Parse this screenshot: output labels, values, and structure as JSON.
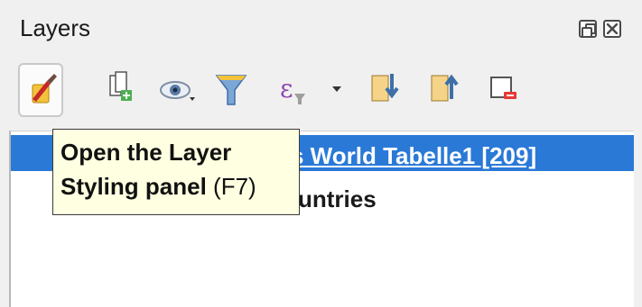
{
  "panel": {
    "title": "Layers",
    "float_icon": "float-panel-icon",
    "close_icon": "close-panel-icon"
  },
  "toolbar": {
    "tools": [
      {
        "name": "style-layers-icon",
        "active": true
      },
      {
        "name": "add-group-icon"
      },
      {
        "name": "visibility-eye-icon",
        "has_dropdown": true
      },
      {
        "name": "filter-legend-icon"
      },
      {
        "name": "filter-by-expression-icon",
        "has_dropdown": true
      },
      {
        "name": "expand-all-icon"
      },
      {
        "name": "collapse-all-icon"
      },
      {
        "name": "remove-layer-icon"
      }
    ]
  },
  "layers": [
    {
      "label_visible": "s  World Tabelle1 [209]",
      "selected": true
    },
    {
      "label_visible": "untries",
      "selected": false
    }
  ],
  "tooltip": {
    "line1": "Open the Layer",
    "line2_bold": "Styling panel",
    "line2_shortcut": " (F7)"
  },
  "colors": {
    "selection": "#2a79d7",
    "tooltip_bg": "#ffffe1",
    "panel_bg": "#f0f0f0"
  }
}
